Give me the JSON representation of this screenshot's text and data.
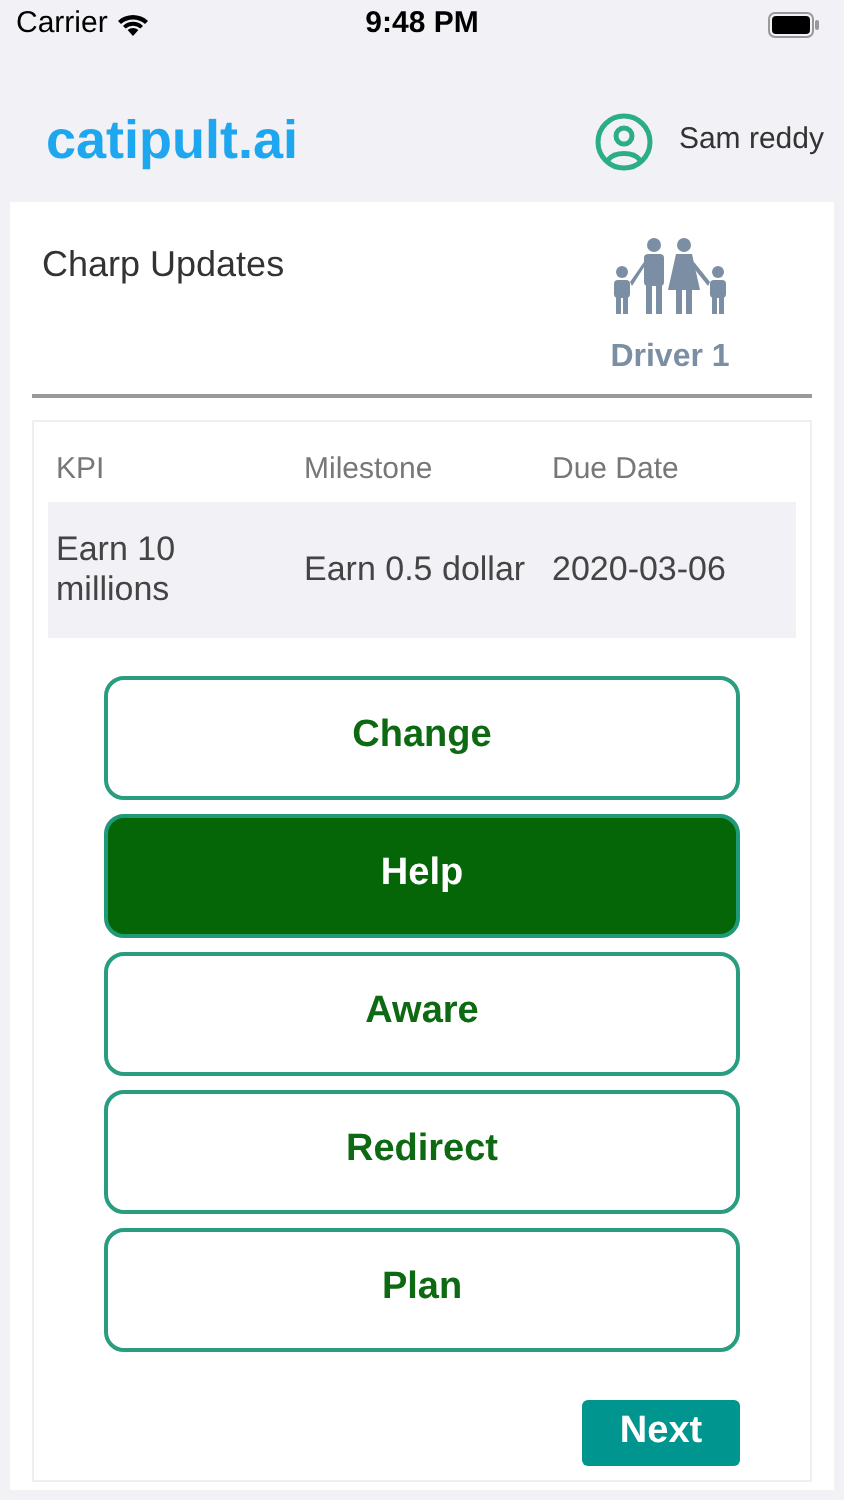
{
  "status_bar": {
    "carrier": "Carrier",
    "time": "9:48 PM"
  },
  "header": {
    "logo": "catipult.ai",
    "user": "Sam reddy"
  },
  "card": {
    "title": "Charp Updates",
    "driver": "Driver 1"
  },
  "table": {
    "columns": [
      "KPI",
      "Milestone",
      "Due Date"
    ],
    "rows": [
      [
        "Earn 10 millions",
        "Earn 0.5 dollar",
        "2020-03-06"
      ]
    ]
  },
  "options": [
    {
      "label": "Change",
      "selected": false
    },
    {
      "label": "Help",
      "selected": true
    },
    {
      "label": "Aware",
      "selected": false
    },
    {
      "label": "Redirect",
      "selected": false
    },
    {
      "label": "Plan",
      "selected": false
    }
  ],
  "next_button": "Next"
}
